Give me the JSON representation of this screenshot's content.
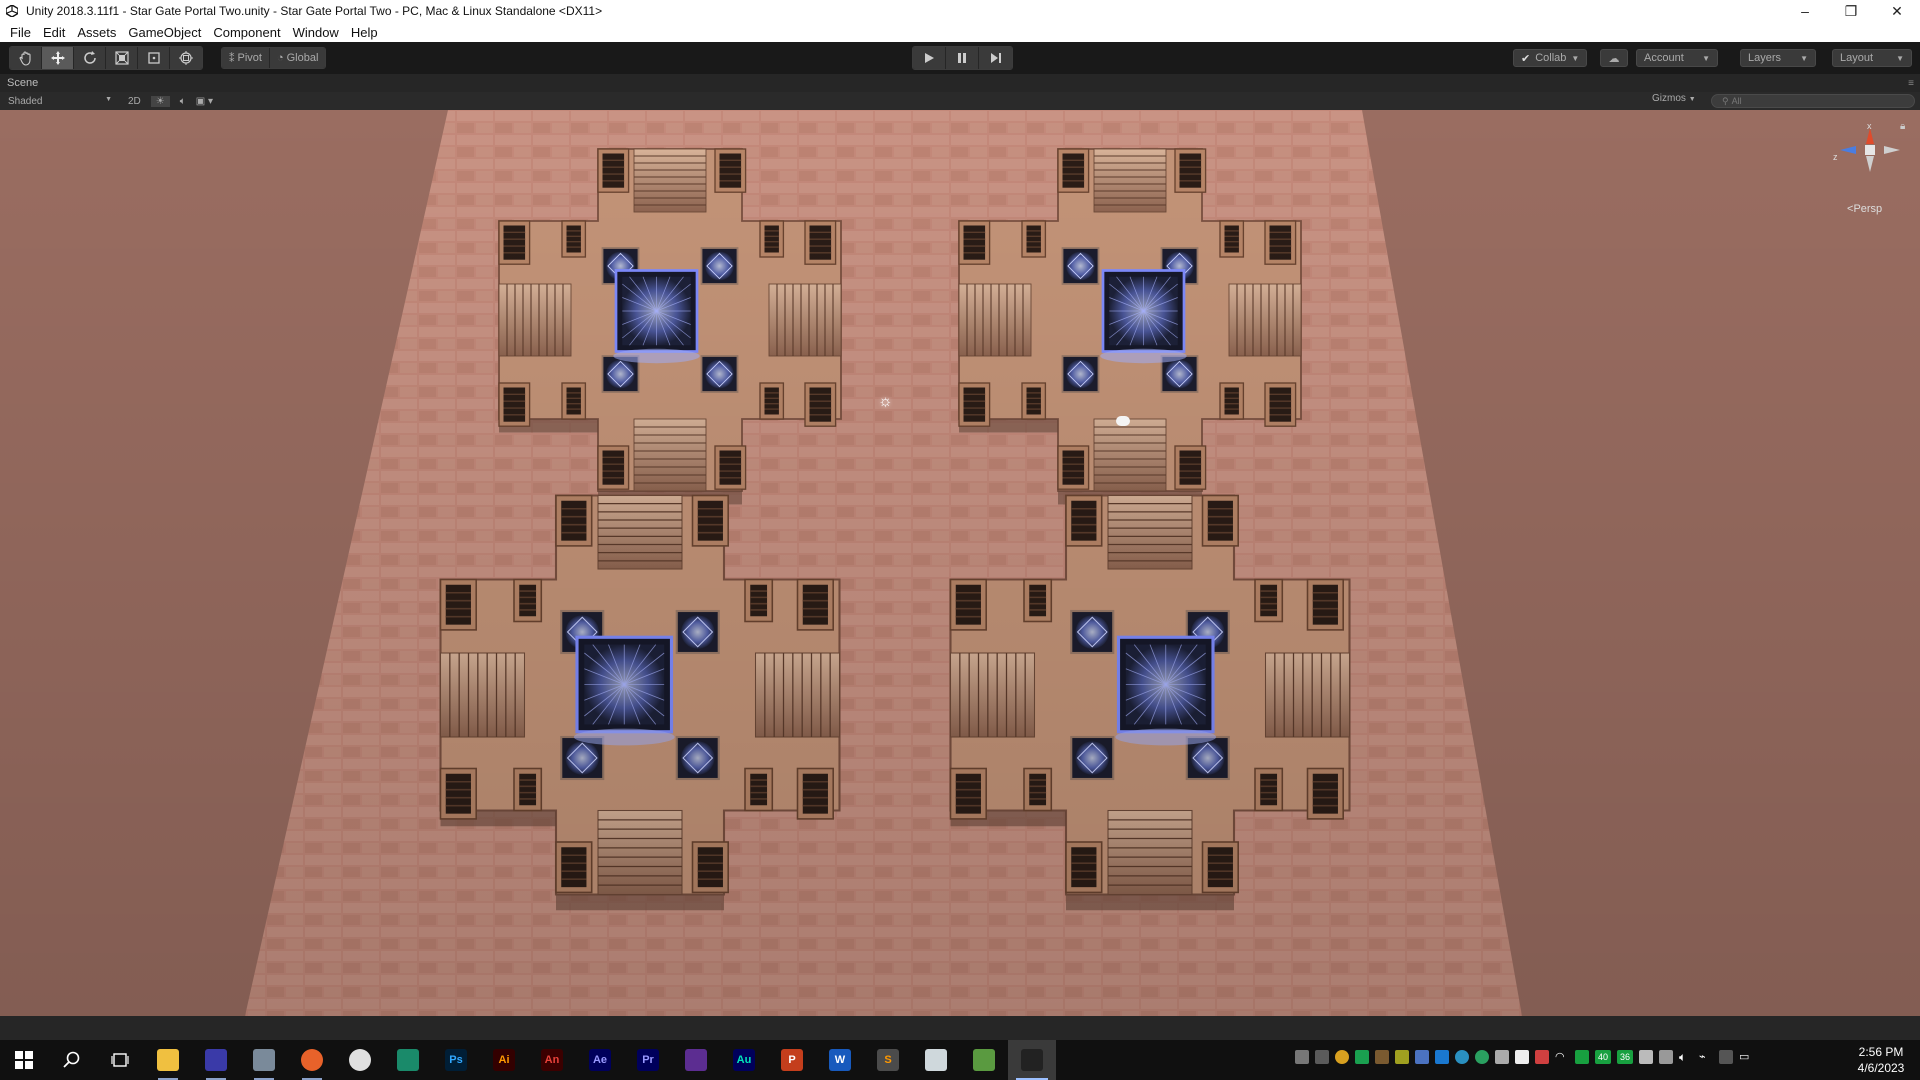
{
  "window": {
    "title": "Unity 2018.3.11f1 - Star Gate Portal Two.unity - Star Gate Portal Two - PC, Mac & Linux Standalone <DX11>",
    "controls": [
      "–",
      "❐",
      "✕"
    ]
  },
  "menu": [
    "File",
    "Edit",
    "Assets",
    "GameObject",
    "Component",
    "Window",
    "Help"
  ],
  "toolbar": {
    "tools": [
      "hand-tool",
      "move-tool",
      "rotate-tool",
      "scale-tool",
      "rect-tool",
      "transform-tool"
    ],
    "pivot_label": "Pivot",
    "global_label": "Global",
    "collab_label": "Collab",
    "account_label": "Account",
    "layers_label": "Layers",
    "layout_label": "Layout"
  },
  "scene": {
    "tab_label": "Scene",
    "shading_mode": "Shaded",
    "mode_2d": "2D",
    "gizmos_label": "Gizmos",
    "search_placeholder": "All",
    "projection_label": "Persp",
    "axis_labels": {
      "x": "x",
      "z": "z"
    }
  },
  "taskbar": {
    "apps": [
      {
        "name": "file-explorer",
        "label": "",
        "color": "#f0c040",
        "fg": "#000"
      },
      {
        "name": "unity-hub",
        "label": "",
        "color": "#3a3aa8",
        "fg": "#fff"
      },
      {
        "name": "unknown-app",
        "label": "",
        "color": "#7a8a9a",
        "fg": "#fff"
      },
      {
        "name": "firefox",
        "label": "",
        "color": "#e8622a",
        "fg": "#fff"
      },
      {
        "name": "chrome",
        "label": "",
        "color": "#e0e0e0",
        "fg": "#000"
      },
      {
        "name": "dreamweaver-like",
        "label": "",
        "color": "#1a8a6a",
        "fg": "#fff"
      },
      {
        "name": "photoshop",
        "label": "Ps",
        "color": "#001e36",
        "fg": "#31a8ff"
      },
      {
        "name": "illustrator",
        "label": "Ai",
        "color": "#330000",
        "fg": "#ff9a00"
      },
      {
        "name": "animate",
        "label": "An",
        "color": "#3b0000",
        "fg": "#e8423a"
      },
      {
        "name": "after-effects",
        "label": "Ae",
        "color": "#00005b",
        "fg": "#9999ff"
      },
      {
        "name": "premiere",
        "label": "Pr",
        "color": "#00005b",
        "fg": "#9999ff"
      },
      {
        "name": "visual-studio",
        "label": "",
        "color": "#5c2d91",
        "fg": "#fff"
      },
      {
        "name": "audition",
        "label": "Au",
        "color": "#00005b",
        "fg": "#00e4bb"
      },
      {
        "name": "powerpoint",
        "label": "P",
        "color": "#c43e1c",
        "fg": "#fff"
      },
      {
        "name": "word",
        "label": "W",
        "color": "#185abd",
        "fg": "#fff"
      },
      {
        "name": "sublime-text",
        "label": "S",
        "color": "#4b4b4b",
        "fg": "#ff9800"
      },
      {
        "name": "notepad",
        "label": "",
        "color": "#cfd8dc",
        "fg": "#000"
      },
      {
        "name": "snip-tool",
        "label": "",
        "color": "#5a9a40",
        "fg": "#fff"
      },
      {
        "name": "unity-editor",
        "label": "",
        "color": "#222",
        "fg": "#fff"
      }
    ],
    "tray_badges": [
      "40",
      "36"
    ],
    "time": "2:56 PM",
    "date": "4/6/2023"
  }
}
